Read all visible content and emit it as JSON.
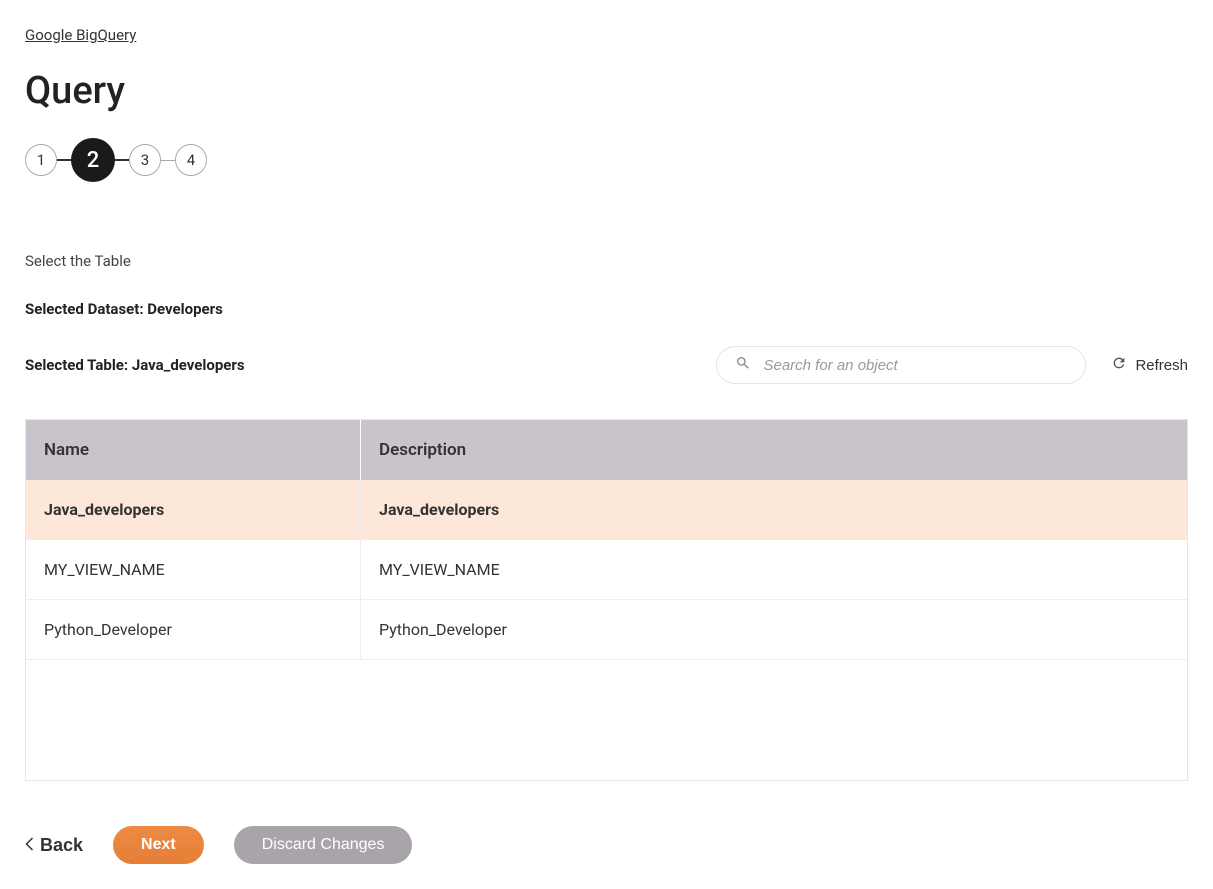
{
  "breadcrumb": {
    "label": "Google BigQuery"
  },
  "page_title": "Query",
  "stepper": {
    "steps": [
      "1",
      "2",
      "3",
      "4"
    ],
    "active_index": 1
  },
  "section": {
    "instruction": "Select the Table",
    "selected_dataset": "Selected Dataset: Developers",
    "selected_table": "Selected Table: Java_developers"
  },
  "search": {
    "placeholder": "Search for an object",
    "value": ""
  },
  "refresh_label": "Refresh",
  "table": {
    "columns": {
      "name": "Name",
      "description": "Description"
    },
    "rows": [
      {
        "name": "Java_developers",
        "description": "Java_developers",
        "selected": true
      },
      {
        "name": "MY_VIEW_NAME",
        "description": "MY_VIEW_NAME",
        "selected": false
      },
      {
        "name": "Python_Developer",
        "description": "Python_Developer",
        "selected": false
      }
    ]
  },
  "footer": {
    "back": "Back",
    "next": "Next",
    "discard": "Discard Changes"
  }
}
